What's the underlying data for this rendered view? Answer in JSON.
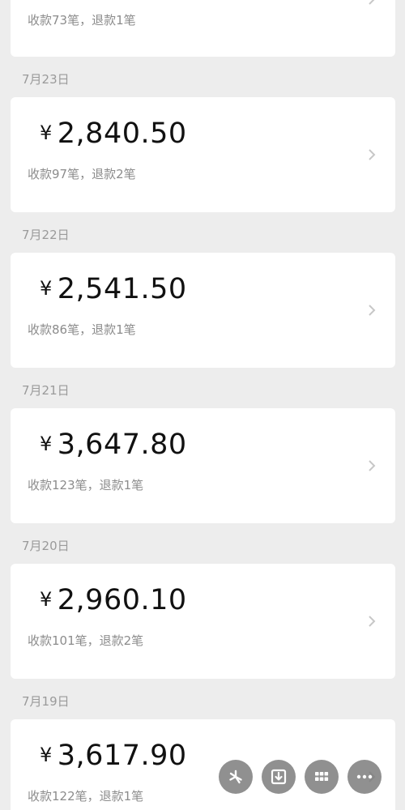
{
  "currency_symbol": "¥",
  "days": [
    {
      "date": "",
      "amount": "",
      "summary": "收款73笔，退款1笔"
    },
    {
      "date": "7月23日",
      "amount": "2,840.50",
      "summary": "收款97笔，退款2笔"
    },
    {
      "date": "7月22日",
      "amount": "2,541.50",
      "summary": "收款86笔，退款1笔"
    },
    {
      "date": "7月21日",
      "amount": "3,647.80",
      "summary": "收款123笔，退款1笔"
    },
    {
      "date": "7月20日",
      "amount": "2,960.10",
      "summary": "收款101笔，退款2笔"
    },
    {
      "date": "7月19日",
      "amount": "3,617.90",
      "summary": "收款122笔，退款1笔"
    }
  ],
  "floating_toolbar": [
    {
      "icon": "pinwheel-icon"
    },
    {
      "icon": "download-icon"
    },
    {
      "icon": "grid-icon"
    },
    {
      "icon": "more-icon"
    }
  ],
  "colors": {
    "background": "#ededed",
    "card": "#ffffff",
    "amount_text": "#111111",
    "secondary_text": "#8c8c8c",
    "date_text": "#9a9a9a",
    "fab": "#787878"
  }
}
